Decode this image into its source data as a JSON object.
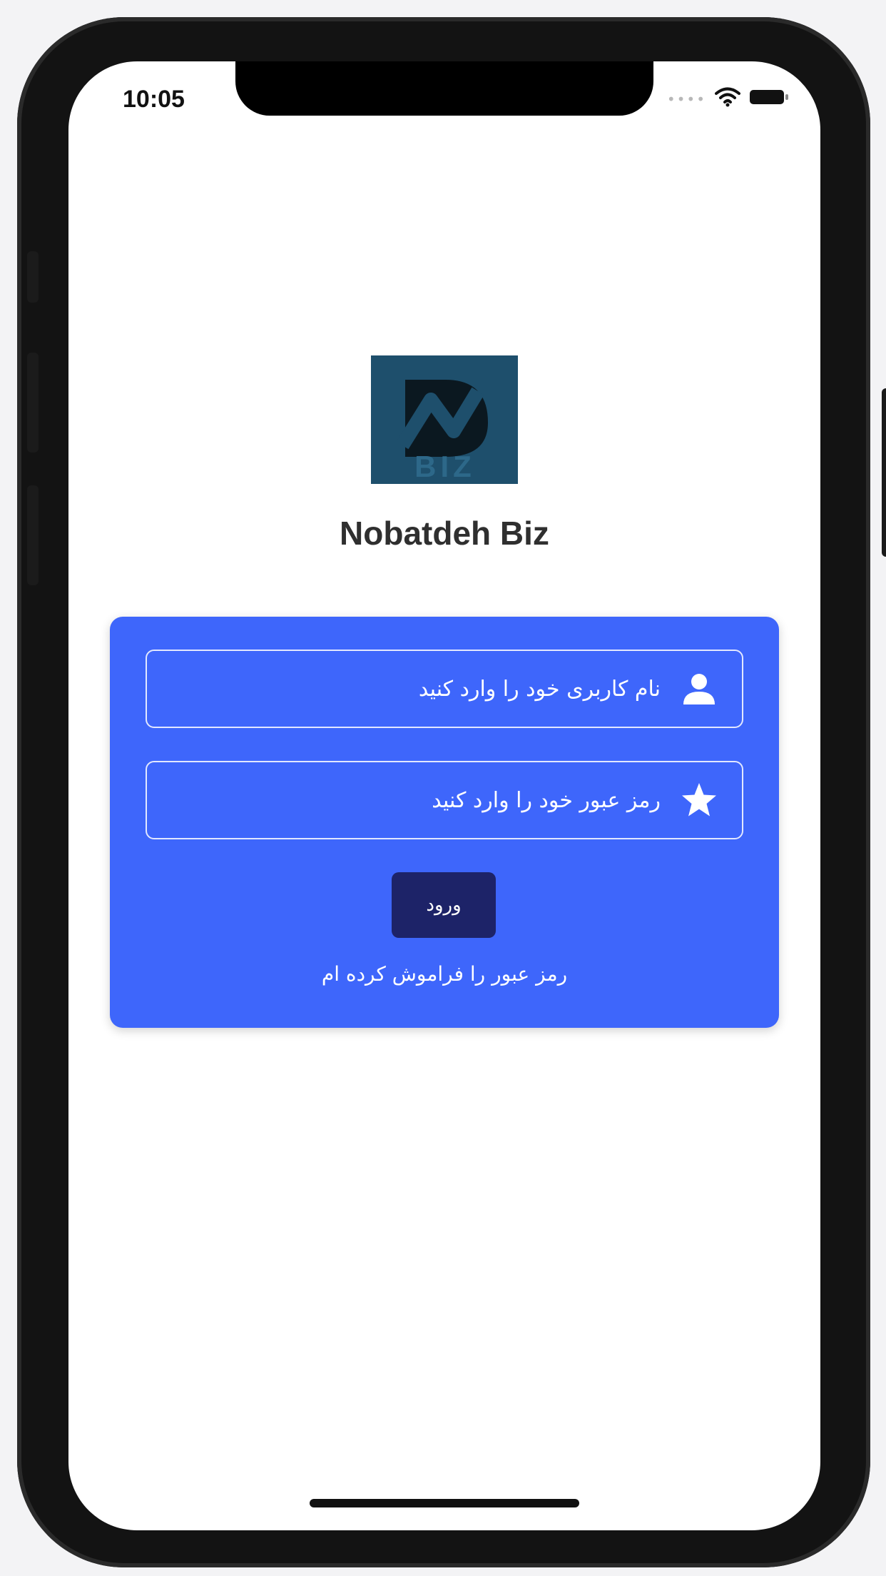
{
  "status_bar": {
    "time": "10:05",
    "signal_icon": "signal-dots-icon",
    "wifi_icon": "wifi-icon",
    "battery_icon": "battery-icon"
  },
  "app": {
    "logo_icon": "nobatdeh-biz-logo",
    "title": "Nobatdeh Biz"
  },
  "login": {
    "username_placeholder": "نام کاربری خود را وارد کنید",
    "username_icon": "user-icon",
    "password_placeholder": "رمز عبور خود را وارد کنید",
    "password_icon": "star-icon",
    "submit_label": "ورود",
    "forgot_label": "رمز عبور را فراموش کرده ام"
  },
  "colors": {
    "card": "#3e66fb",
    "button": "#1d2368",
    "logo_bg": "#1e4f6c"
  }
}
